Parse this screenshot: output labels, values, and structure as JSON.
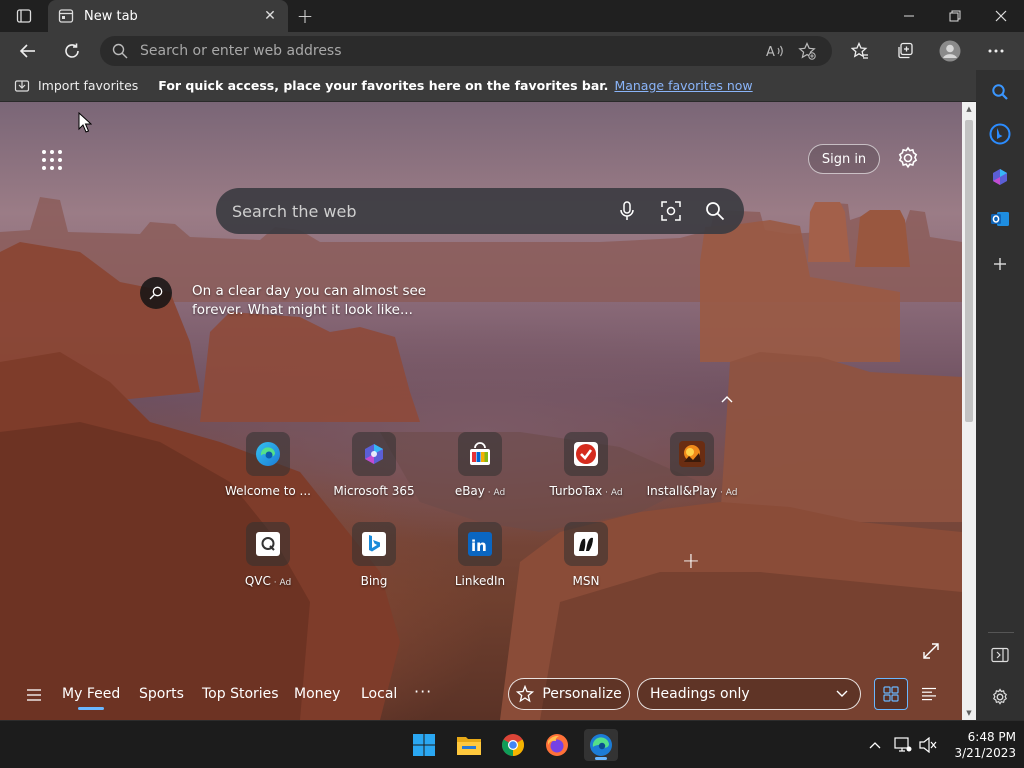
{
  "browser": {
    "tab_title": "New tab",
    "new_tab_symbol": "+",
    "tab_close_symbol": "✕"
  },
  "address_bar": {
    "placeholder": "Search or enter web address"
  },
  "favorites_bar": {
    "import_label": "Import favorites",
    "message": "For quick access, place your favorites here on the favorites bar.",
    "manage_link": "Manage favorites now"
  },
  "page": {
    "signin_label": "Sign in",
    "search_placeholder": "Search the web",
    "caption_text": "On a clear day you can almost see forever. What might it look like...",
    "tiles_row1": [
      {
        "label": "Welcome to ...",
        "ad": "",
        "icon": "edge-icon"
      },
      {
        "label": "Microsoft 365",
        "ad": "",
        "icon": "microsoft-365-icon"
      },
      {
        "label": "eBay",
        "ad": " · Ad",
        "icon": "ebay-icon"
      },
      {
        "label": "TurboTax",
        "ad": " · Ad",
        "icon": "turbotax-icon"
      },
      {
        "label": "Install&Play",
        "ad": " · Ad",
        "icon": "install-play-icon"
      }
    ],
    "tiles_row2": [
      {
        "label": "QVC",
        "ad": " · Ad",
        "icon": "qvc-icon"
      },
      {
        "label": "Bing",
        "ad": "",
        "icon": "bing-icon"
      },
      {
        "label": "LinkedIn",
        "ad": "",
        "icon": "linkedin-icon"
      },
      {
        "label": "MSN",
        "ad": "",
        "icon": "msn-icon"
      }
    ],
    "add_tile_symbol": "+"
  },
  "feed": {
    "tabs": [
      "My Feed",
      "Sports",
      "Top Stories",
      "Money",
      "Local"
    ],
    "more_label": "···",
    "personalize_label": "Personalize",
    "layout_select": "Headings only"
  },
  "taskbar": {
    "time": "6:48 PM",
    "date": "3/21/2023"
  },
  "colors": {
    "accent": "#6ab7ff",
    "titlebar": "#202020",
    "toolbar": "#3b3b3b",
    "link": "#8ab4f8"
  }
}
